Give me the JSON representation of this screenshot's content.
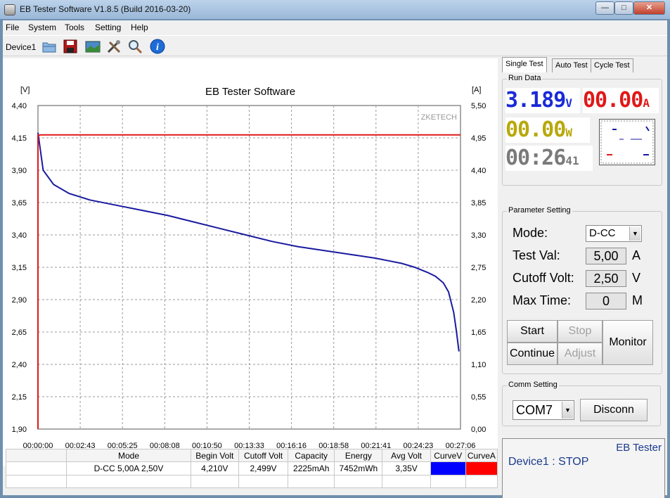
{
  "window": {
    "title": "EB Tester Software V1.8.5 (Build 2016-03-20)"
  },
  "menu": [
    "File",
    "System",
    "Tools",
    "Setting",
    "Help"
  ],
  "toolbar": {
    "device": "Device1"
  },
  "chart_data": {
    "type": "line",
    "title": "EB Tester Software",
    "watermark": "ZKETECH",
    "y_left_unit": "[V]",
    "y_right_unit": "[A]",
    "y_left_ticks": [
      "4,40",
      "4,15",
      "3,90",
      "3,65",
      "3,40",
      "3,15",
      "2,90",
      "2,65",
      "2,40",
      "2,15",
      "1,90"
    ],
    "y_right_ticks": [
      "5,50",
      "4,95",
      "4,40",
      "3,85",
      "3,30",
      "2,75",
      "2,20",
      "1,65",
      "1,10",
      "0,55",
      "0,00"
    ],
    "x_ticks": [
      "00:00:00",
      "00:02:43",
      "00:05:25",
      "00:08:08",
      "00:10:50",
      "00:13:33",
      "00:16:16",
      "00:18:58",
      "00:21:41",
      "00:24:23",
      "00:27:06"
    ],
    "ylim_left": [
      1.9,
      4.4
    ],
    "ylim_right": [
      0.0,
      5.5
    ],
    "xlim_seconds": [
      0,
      1626
    ],
    "grid": true,
    "series": [
      {
        "color": "#1a1aa0",
        "axis": "left",
        "x": [
          0,
          20,
          60,
          120,
          200,
          300,
          400,
          500,
          600,
          700,
          800,
          900,
          1000,
          1100,
          1200,
          1300,
          1350,
          1400,
          1450,
          1500,
          1530,
          1560,
          1580,
          1600,
          1610,
          1620
        ],
        "y": [
          4.19,
          3.9,
          3.79,
          3.72,
          3.67,
          3.63,
          3.59,
          3.55,
          3.5,
          3.45,
          3.4,
          3.35,
          3.31,
          3.28,
          3.25,
          3.22,
          3.2,
          3.18,
          3.15,
          3.11,
          3.08,
          3.03,
          2.96,
          2.8,
          2.66,
          2.5
        ]
      },
      {
        "color": "#e01818",
        "axis": "right",
        "x": [
          0,
          0,
          10,
          1626
        ],
        "y": [
          0.0,
          4.99,
          5.0,
          5.0
        ]
      }
    ]
  },
  "table": {
    "headers": [
      "",
      "Mode",
      "Begin Volt",
      "Cutoff Volt",
      "Capacity",
      "Energy",
      "Avg Volt",
      "CurveV",
      "CurveA"
    ],
    "row": [
      "",
      "D-CC  5,00A  2,50V",
      "4,210V",
      "2,499V",
      "2225mAh",
      "7452mWh",
      "3,35V",
      "",
      ""
    ],
    "curve_v_color": "#0000ff",
    "curve_a_color": "#ff0000"
  },
  "tabs": [
    "Single Test",
    "Auto Test",
    "Cycle Test"
  ],
  "run_data": {
    "title": "Run Data",
    "voltage": "3.189",
    "voltage_unit": "V",
    "voltage_color": "#1a2ad8",
    "current": "00.00",
    "current_unit": "A",
    "current_color": "#e01818",
    "power": "00.00",
    "power_unit": "W",
    "power_color": "#b8a80c",
    "time": "00:26",
    "time_sec": "41",
    "time_color": "#7a7a7a"
  },
  "param": {
    "title": "Parameter Setting",
    "mode_label": "Mode:",
    "mode_value": "D-CC",
    "test_label": "Test Val:",
    "test_value": "5,00",
    "test_unit": "A",
    "cutoff_label": "Cutoff Volt:",
    "cutoff_value": "2,50",
    "cutoff_unit": "V",
    "maxtime_label": "Max Time:",
    "maxtime_value": "0",
    "maxtime_unit": "M"
  },
  "buttons": {
    "start": "Start",
    "stop": "Stop",
    "continue": "Continue",
    "adjust": "Adjust",
    "monitor": "Monitor"
  },
  "comm": {
    "title": "Comm Setting",
    "port": "COM7",
    "disconn": "Disconn"
  },
  "status": {
    "brand": "EB Tester",
    "text": "Device1 : STOP"
  }
}
